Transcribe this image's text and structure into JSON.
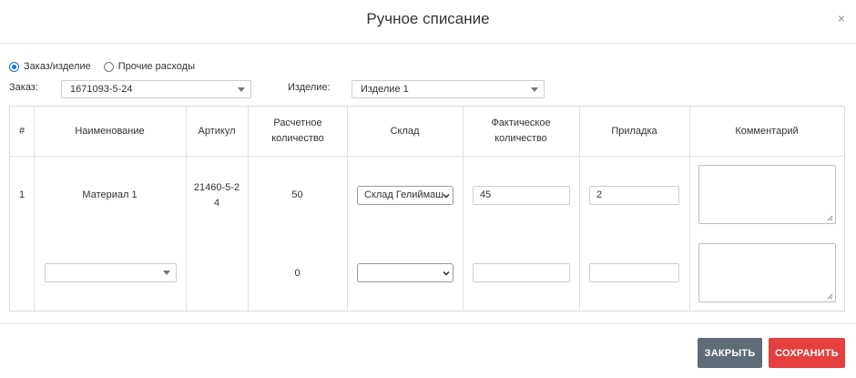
{
  "dialog": {
    "title": "Ручное списание",
    "close_glyph": "×"
  },
  "mode": {
    "options": [
      {
        "label": "Заказ/изделие",
        "checked": true
      },
      {
        "label": "Прочие расходы",
        "checked": false
      }
    ]
  },
  "filters": {
    "order_label": "Заказ:",
    "order_value": "1671093-5-24",
    "product_label": "Изделие:",
    "product_value": "Изделие 1"
  },
  "table": {
    "columns": [
      "#",
      "Наименование",
      "Артикул",
      "Расчетное количество",
      "Склад",
      "Фактическое количество",
      "Приладка",
      "Комментарий"
    ],
    "rows": [
      {
        "num": "1",
        "name": "Материал 1",
        "article": "21460-5-24",
        "calc_qty": "50",
        "warehouse": "Склад Гелиймаш",
        "actual_qty": "45",
        "setup": "2",
        "comment": ""
      },
      {
        "num": "",
        "name": "",
        "article": "",
        "calc_qty": "0",
        "warehouse": "",
        "actual_qty": "",
        "setup": "",
        "comment": ""
      }
    ]
  },
  "footer": {
    "close_label": "ЗАКРЫТЬ",
    "save_label": "СОХРАНИТЬ"
  },
  "colors": {
    "accent": "#1a73e8",
    "close_btn": "#5f6b77",
    "save_btn": "#e53f3f"
  }
}
